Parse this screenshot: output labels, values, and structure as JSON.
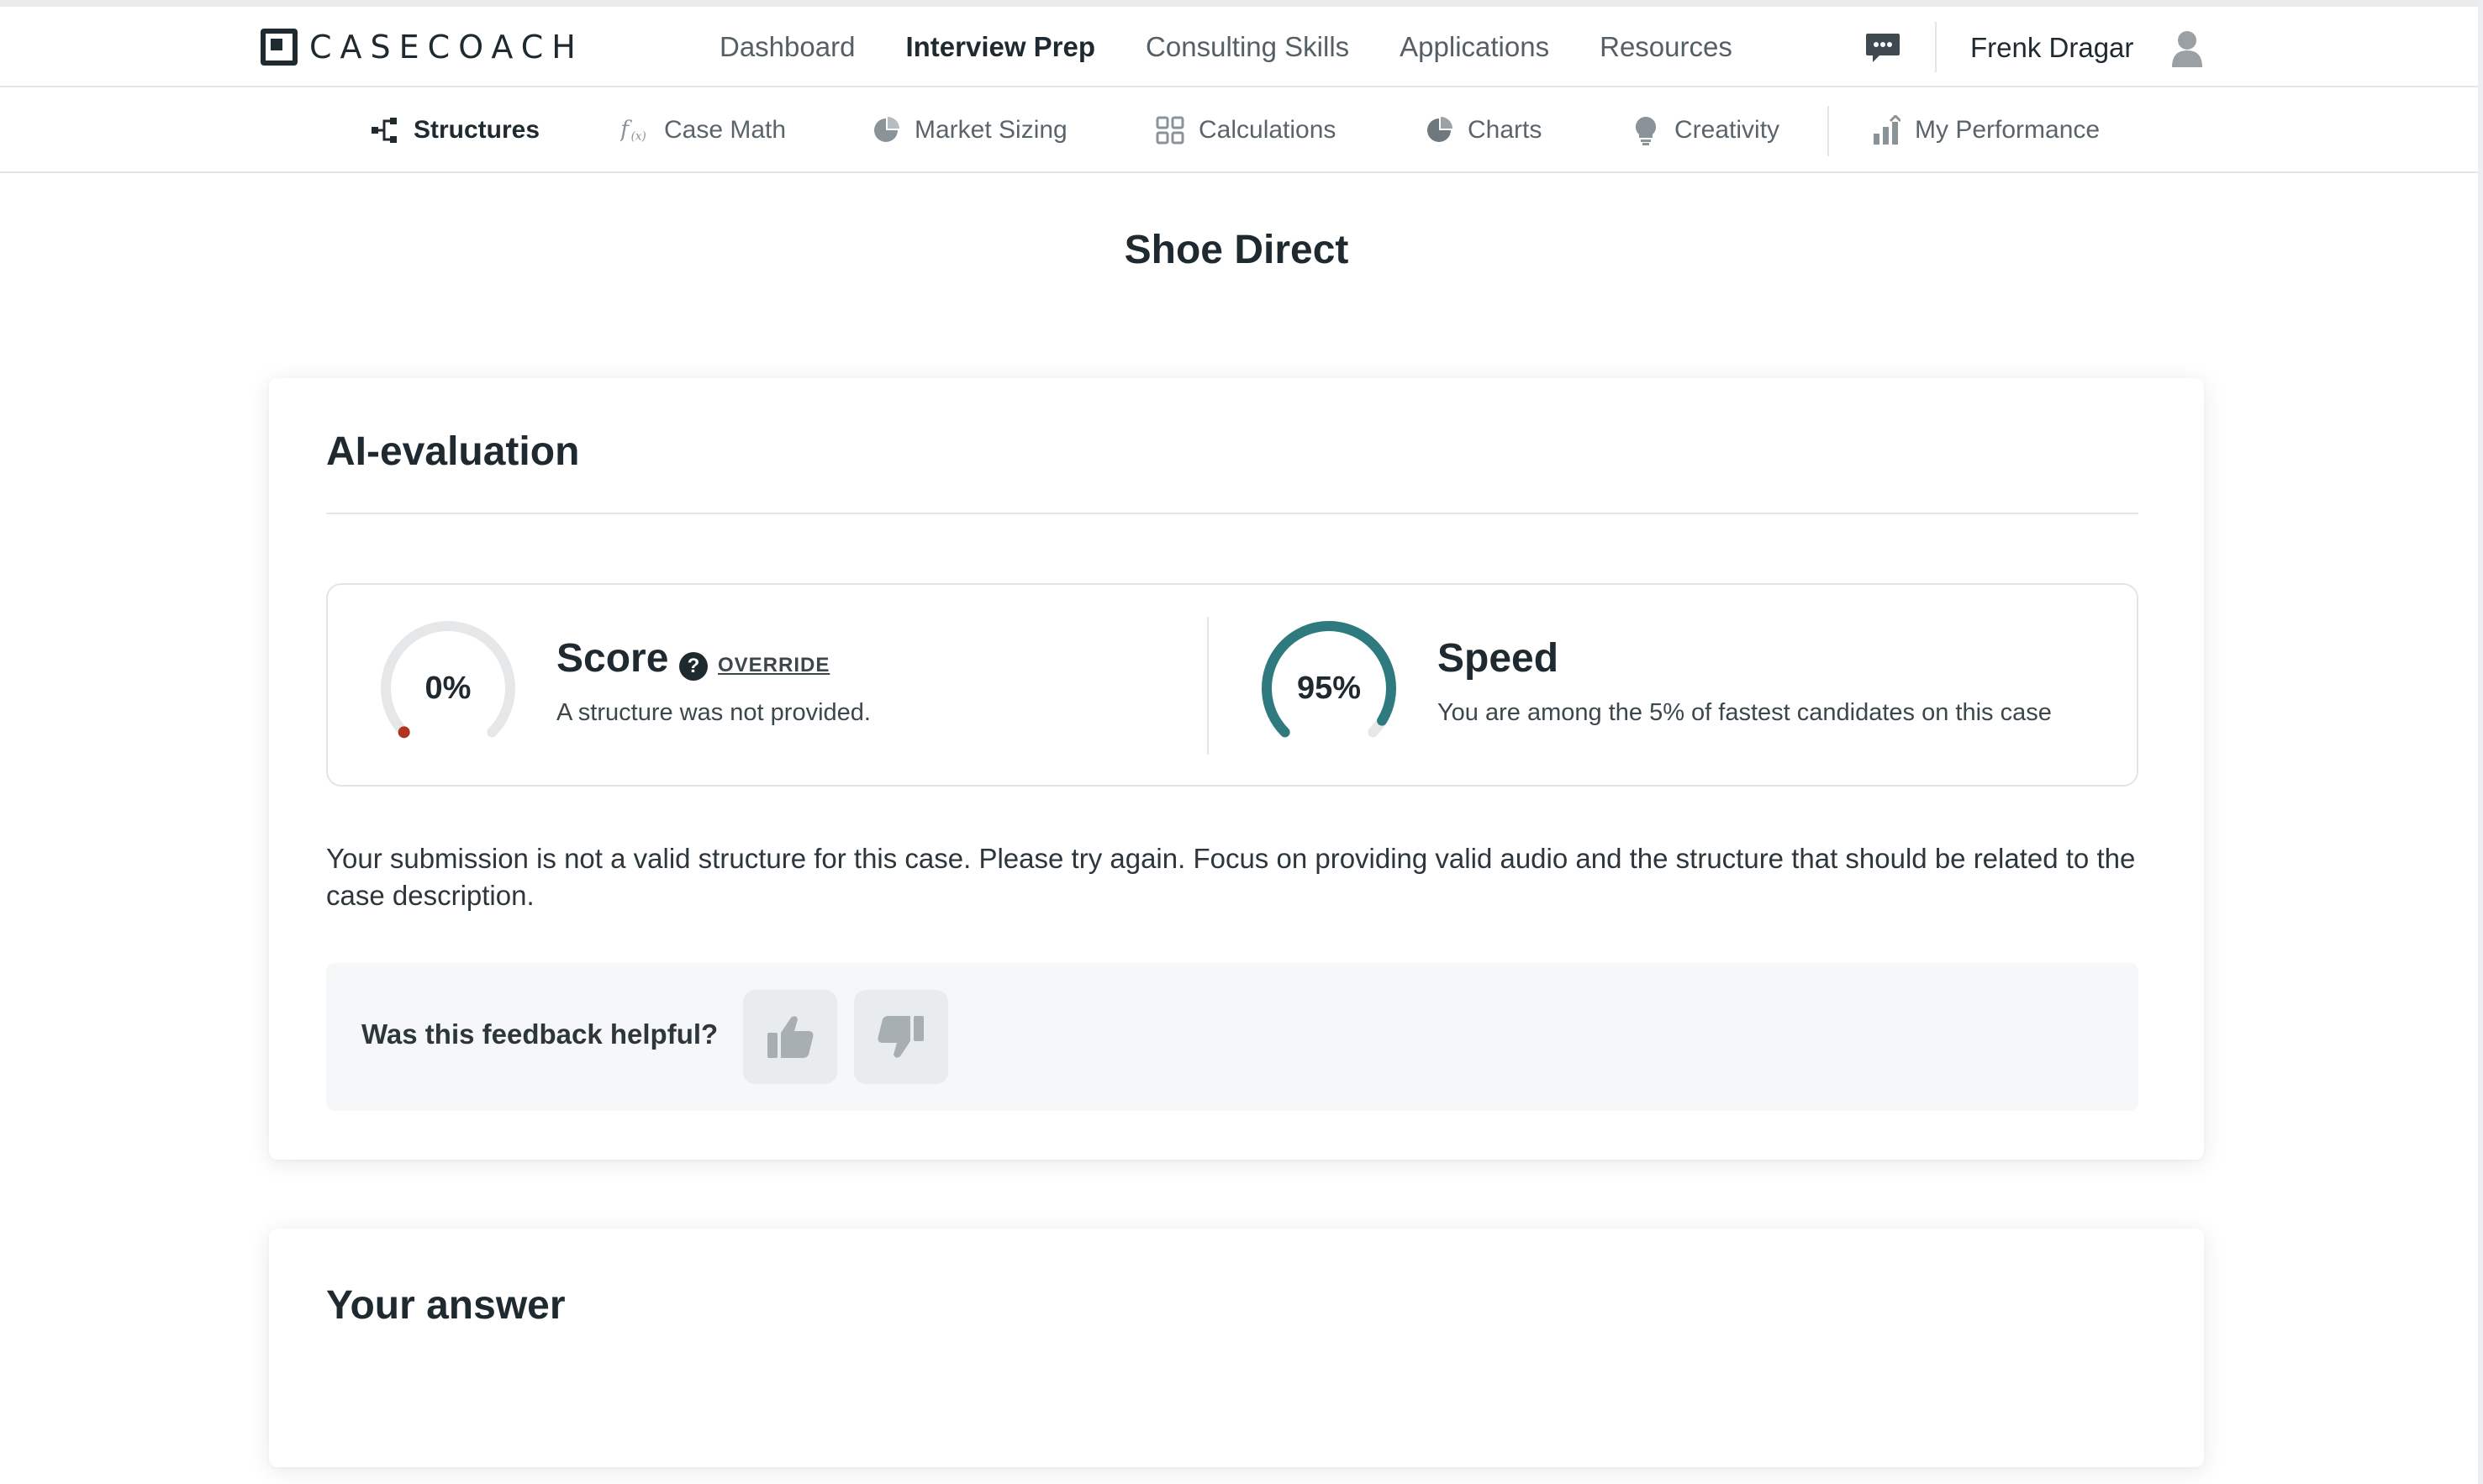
{
  "brand": {
    "logo_text": "CASECOACH"
  },
  "nav": {
    "items": [
      {
        "label": "Dashboard",
        "active": false
      },
      {
        "label": "Interview Prep",
        "active": true
      },
      {
        "label": "Consulting Skills",
        "active": false
      },
      {
        "label": "Applications",
        "active": false
      },
      {
        "label": "Resources",
        "active": false
      }
    ]
  },
  "user": {
    "name": "Frenk Dragar"
  },
  "subnav": {
    "items": [
      {
        "label": "Structures",
        "icon": "structure-icon",
        "active": true
      },
      {
        "label": "Case Math",
        "icon": "function-icon",
        "active": false
      },
      {
        "label": "Market Sizing",
        "icon": "pie-chart-icon",
        "active": false
      },
      {
        "label": "Calculations",
        "icon": "grid-icon",
        "active": false
      },
      {
        "label": "Charts",
        "icon": "pie-chart-icon",
        "active": false
      },
      {
        "label": "Creativity",
        "icon": "lightbulb-icon",
        "active": false
      },
      {
        "label": "My Performance",
        "icon": "bar-chart-icon",
        "active": false
      }
    ]
  },
  "page": {
    "title": "Shoe Direct"
  },
  "evaluation": {
    "heading": "AI-evaluation",
    "score": {
      "value": 0,
      "display": "0%",
      "title": "Score",
      "help": "?",
      "override_label": "OVERRIDE",
      "description": "A structure was not provided.",
      "indicator_color": "#b0321f"
    },
    "speed": {
      "value": 95,
      "display": "95%",
      "title": "Speed",
      "description": "You are among the 5% of fastest candidates on this case",
      "color": "#2f7a7f"
    },
    "feedback": "Your submission is not a valid structure for this case. Please try again. Focus on providing valid audio and the structure that should be related to the case description.",
    "helpful": {
      "question": "Was this feedback helpful?"
    }
  },
  "answer": {
    "heading": "Your answer"
  },
  "colors": {
    "accent": "#2f7a7f",
    "text": "#1f2a30",
    "muted": "#5a656b",
    "track": "#e6e7e9"
  }
}
